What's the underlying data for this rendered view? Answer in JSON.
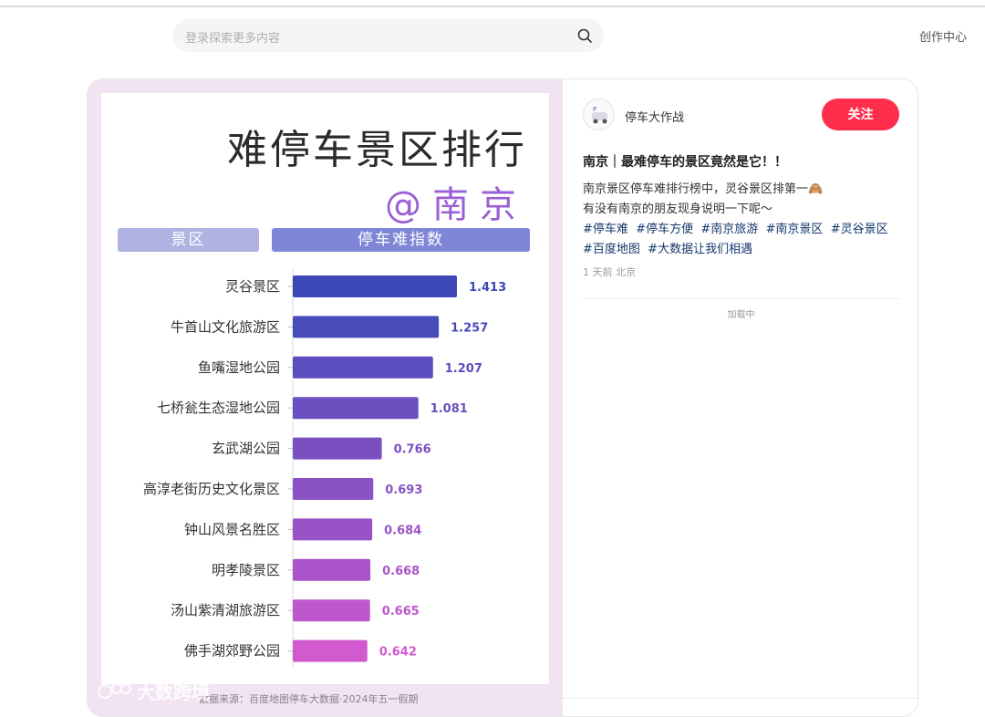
{
  "header": {
    "search_placeholder": "登录探索更多内容",
    "creator_center": "创作中心"
  },
  "poster": {
    "title": "难停车景区排行",
    "city": "@南京",
    "col_a": "景区",
    "col_b": "停车难指数",
    "source": "数据来源：百度地图停车大数据·2024年五一假期",
    "watermark": "大数跨境"
  },
  "chart_data": {
    "type": "bar",
    "orientation": "horizontal",
    "categories": [
      "灵谷景区",
      "牛首山文化旅游区",
      "鱼嘴湿地公园",
      "七桥瓮生态湿地公园",
      "玄武湖公园",
      "高淳老街历史文化景区",
      "钟山风景名胜区",
      "明孝陵景区",
      "汤山紫清湖旅游区",
      "佛手湖郊野公园"
    ],
    "values": [
      1.413,
      1.257,
      1.207,
      1.081,
      0.766,
      0.693,
      0.684,
      0.668,
      0.665,
      0.642
    ],
    "value_labels": [
      "1.413",
      "1.257",
      "1.207",
      "1.081",
      "0.766",
      "0.693",
      "0.684",
      "0.668",
      "0.665",
      "0.642"
    ],
    "xlim": [
      0,
      1.413
    ],
    "colors": [
      "#3d48b8",
      "#4a4bba",
      "#5a4dbd",
      "#6a4fbf",
      "#7a50c1",
      "#8a52c3",
      "#9a53c6",
      "#aa55c9",
      "#bd57cc",
      "#d15acf"
    ]
  },
  "note": {
    "author": "停车大作战",
    "follow_label": "关注",
    "title": "南京｜最难停车的景区竟然是它！！",
    "line1": "南京景区停车难排行榜中，灵谷景区排第一🙈",
    "line2": "有没有南京的朋友现身说明一下呢～",
    "tags": [
      "#停车难",
      "#停车方便",
      "#南京旅游",
      "#南京景区",
      "#灵谷景区",
      "#百度地图",
      "#大数据让我们相遇"
    ],
    "meta": "1 天前 北京",
    "loading": "加载中"
  }
}
